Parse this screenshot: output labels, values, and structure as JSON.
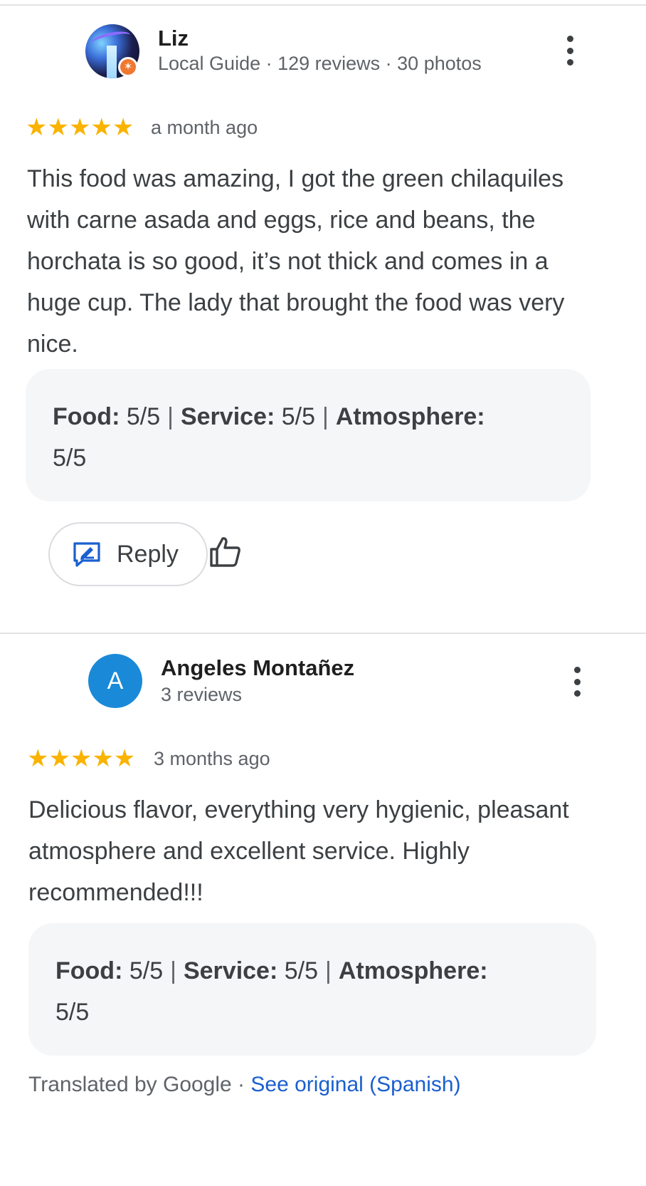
{
  "reviews": [
    {
      "author": "Liz",
      "meta": "Local Guide · 129 reviews · 30 photos",
      "rating": 5,
      "stars": "★★★★★",
      "time": "a month ago",
      "text": "This food was amazing, I got the green chilaquiles with carne asada and eggs, rice and beans, the horchata is so good, it’s not thick and comes in a huge cup. The lady that brought the food was very nice.",
      "ratings": {
        "food_label": "Food:",
        "food_value": " 5/5",
        "service_label": "Service:",
        "service_value": " 5/5",
        "atmosphere_label": "Atmosphere:",
        "atmosphere_value": "5/5",
        "separator": "|"
      },
      "reply_label": "Reply",
      "avatar_badge_icon": "local-guide-star-icon",
      "badge_color": "#f0782f"
    },
    {
      "author": "Angeles Montañez",
      "meta": "3 reviews",
      "avatar_letter": "A",
      "avatar_color": "#1a8ad8",
      "rating": 5,
      "stars": "★★★★★",
      "time": "3 months ago",
      "text": "Delicious flavor, everything very hygienic, pleasant atmosphere and excellent service. Highly recommended!!!",
      "ratings": {
        "food_label": "Food:",
        "food_value": " 5/5",
        "service_label": "Service:",
        "service_value": " 5/5",
        "atmosphere_label": "Atmosphere:",
        "atmosphere_value": "5/5",
        "separator": "|"
      },
      "translated_prefix": "Translated by Google · ",
      "see_original": "See original (Spanish)"
    }
  ],
  "colors": {
    "star": "#f9b300",
    "link": "#1a5fd0",
    "ratings_bg": "#f5f6f8"
  }
}
